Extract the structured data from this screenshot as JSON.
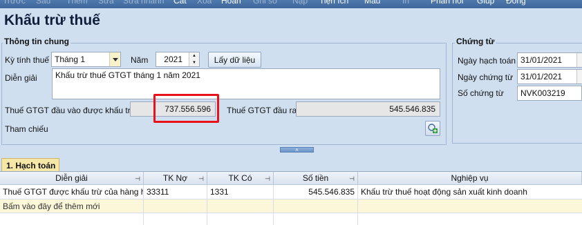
{
  "toolbar": {
    "items": [
      {
        "label": "Trước",
        "enabled": false
      },
      {
        "label": "Sau",
        "enabled": false
      },
      {
        "label": "Thêm",
        "enabled": false
      },
      {
        "label": "Sửa",
        "enabled": false
      },
      {
        "label": "Sửa nhanh",
        "enabled": false
      },
      {
        "label": "Cất",
        "enabled": true
      },
      {
        "label": "Xóa",
        "enabled": false
      },
      {
        "label": "Hoãn",
        "enabled": true
      },
      {
        "label": "Ghi sổ",
        "enabled": false
      },
      {
        "label": "Nạp",
        "enabled": false
      },
      {
        "label": "Tiện ích",
        "enabled": true
      },
      {
        "label": "Mẫu",
        "enabled": true
      },
      {
        "label": "In",
        "enabled": false
      },
      {
        "label": "Phản hồi",
        "enabled": true
      },
      {
        "label": "Giúp",
        "enabled": true
      },
      {
        "label": "Đóng",
        "enabled": true
      }
    ]
  },
  "page_title": "Khấu trừ thuế",
  "general": {
    "group_title": "Thông tin chung",
    "period_label": "Kỳ tính thuế",
    "period_value": "Tháng 1",
    "year_label": "Năm",
    "year_value": "2021",
    "load_button": "Lấy dữ liệu",
    "description_label": "Diễn giải",
    "description_value": "Khấu trừ thuế GTGT tháng 1 năm 2021",
    "input_vat_label": "Thuế GTGT đầu vào được khấu trừ",
    "input_vat_value": "737.556.596",
    "output_vat_label": "Thuế GTGT đầu ra",
    "output_vat_value": "545.546.835",
    "reference_label": "Tham chiếu"
  },
  "voucher": {
    "group_title": "Chứng từ",
    "posting_date_label": "Ngày hạch toán",
    "posting_date_value": "31/01/2021",
    "voucher_date_label": "Ngày chứng từ",
    "voucher_date_value": "31/01/2021",
    "voucher_no_label": "Số chứng từ",
    "voucher_no_value": "NVK003219"
  },
  "tab": {
    "label": "1. Hạch toán"
  },
  "grid": {
    "columns": [
      "Diễn giải",
      "TK Nợ",
      "TK Có",
      "Số tiền",
      "Nghiệp vụ"
    ],
    "rows": [
      [
        "Thuế GTGT được khấu trừ của hàng hó",
        "33311",
        "1331",
        "545.546.835",
        "Khấu trừ thuế hoạt động sản xuất kinh doanh"
      ]
    ],
    "new_row_hint": "Bấm vào đây để thêm mới"
  },
  "colors": {
    "highlight": "#e8121a",
    "tab_active": "#f7e7a6",
    "background": "#cfdff0"
  }
}
